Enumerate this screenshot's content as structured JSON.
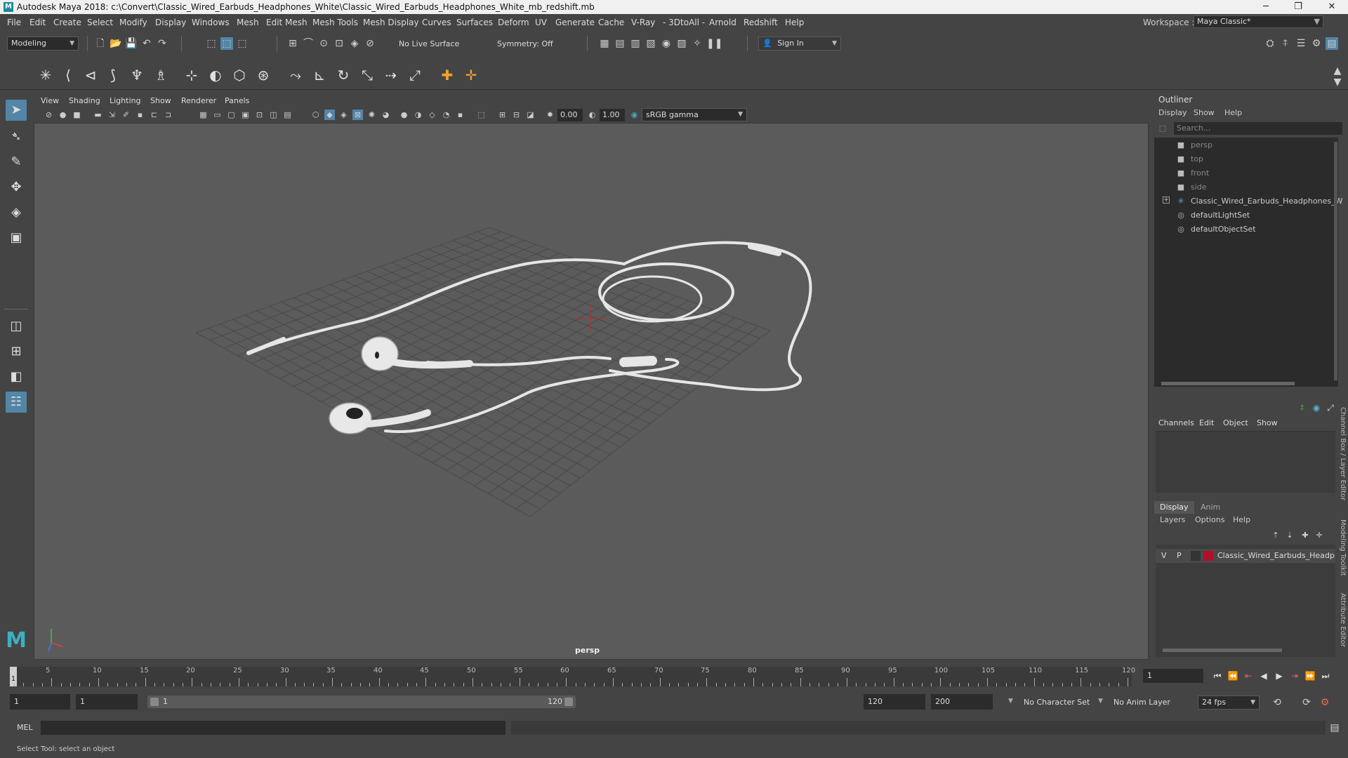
{
  "window": {
    "title": "Autodesk Maya 2018: c:\\Convert\\Classic_Wired_Earbuds_Headphones_White\\Classic_Wired_Earbuds_Headphones_White_mb_redshift.mb",
    "minimize": "─",
    "maximize": "❐",
    "close": "✕"
  },
  "menubar": {
    "items": [
      "File",
      "Edit",
      "Create",
      "Select",
      "Modify",
      "Display",
      "Windows",
      "Mesh",
      "Edit Mesh",
      "Mesh Tools",
      "Mesh Display",
      "Curves",
      "Surfaces",
      "Deform",
      "UV",
      "Generate",
      "Cache",
      "V-Ray",
      "- 3DtoAll -",
      "Arnold",
      "Redshift",
      "Help"
    ],
    "workspace_label": "Workspace :",
    "workspace_value": "Maya Classic*"
  },
  "statusline": {
    "menuset": "Modeling",
    "live_surface": "No Live Surface",
    "symmetry": "Symmetry: Off",
    "sign_in": "Sign In"
  },
  "viewport": {
    "menu": [
      "View",
      "Shading",
      "Lighting",
      "Show",
      "Renderer",
      "Panels"
    ],
    "exposure": "0.00",
    "gamma": "1.00",
    "color_space": "sRGB gamma",
    "camera_label": "persp"
  },
  "outliner": {
    "title": "Outliner",
    "menu": [
      "Display",
      "Show",
      "Help"
    ],
    "search_placeholder": "Search...",
    "items": [
      {
        "label": "persp",
        "dim": true,
        "icon": "camera-icon"
      },
      {
        "label": "top",
        "dim": true,
        "icon": "camera-icon"
      },
      {
        "label": "front",
        "dim": true,
        "icon": "camera-icon"
      },
      {
        "label": "side",
        "dim": true,
        "icon": "camera-icon"
      },
      {
        "label": "Classic_Wired_Earbuds_Headphones_W",
        "dim": false,
        "icon": "transform-icon"
      },
      {
        "label": "defaultLightSet",
        "dim": false,
        "icon": "set-icon"
      },
      {
        "label": "defaultObjectSet",
        "dim": false,
        "icon": "set-icon"
      }
    ]
  },
  "channelbox": {
    "menu": [
      "Channels",
      "Edit",
      "Object",
      "Show"
    ]
  },
  "layereditor": {
    "tabs": [
      "Display",
      "Anim"
    ],
    "menu": [
      "Layers",
      "Options",
      "Help"
    ],
    "layer": {
      "v": "V",
      "p": "P",
      "name": "Classic_Wired_Earbuds_Headp",
      "color": "#b0102a"
    }
  },
  "side_tabs": [
    "Channel Box / Layer Editor",
    "Modeling Toolkit",
    "Attribute Editor"
  ],
  "timeslider": {
    "ticks": [
      "5",
      "10",
      "15",
      "20",
      "25",
      "30",
      "35",
      "40",
      "45",
      "50",
      "55",
      "60",
      "65",
      "70",
      "75",
      "80",
      "85",
      "90",
      "95",
      "100",
      "105",
      "110",
      "115",
      "120"
    ],
    "current_frame_marker": "1",
    "current_frame": "1"
  },
  "rangeslider": {
    "start": "1",
    "anim_start": "1",
    "range_start": "1",
    "range_end": "120",
    "end": "120",
    "anim_end": "200",
    "character_set": "No Character Set",
    "anim_layer": "No Anim Layer",
    "fps": "24 fps"
  },
  "cmdline": {
    "label": "MEL"
  },
  "helpline": {
    "text": "Select Tool: select an object"
  }
}
